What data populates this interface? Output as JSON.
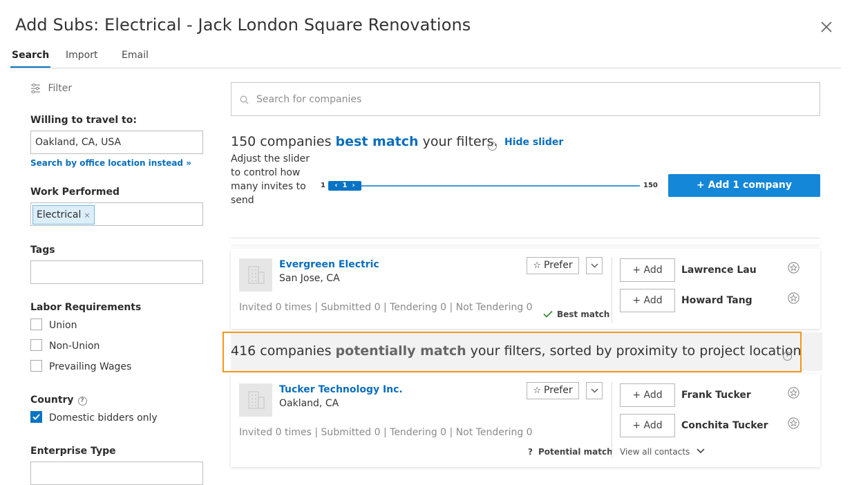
{
  "dialog": {
    "title": "Add Subs: Electrical - Jack London Square Renovations",
    "tabs": [
      {
        "label": "Search",
        "active": true
      },
      {
        "label": "Import",
        "active": false
      },
      {
        "label": "Email",
        "active": false
      }
    ]
  },
  "sidebar": {
    "filter_label": "Filter",
    "travel": {
      "label": "Willing to travel to:",
      "value": "Oakland, CA, USA",
      "office_link": "Search by office location instead »"
    },
    "work_performed": {
      "label": "Work Performed",
      "chip": "Electrical"
    },
    "tags": {
      "label": "Tags",
      "value": ""
    },
    "labor": {
      "label": "Labor Requirements",
      "options": [
        {
          "label": "Union",
          "checked": false
        },
        {
          "label": "Non-Union",
          "checked": false
        },
        {
          "label": "Prevailing Wages",
          "checked": false
        }
      ]
    },
    "country": {
      "label": "Country",
      "options": [
        {
          "label": "Domestic bidders only",
          "checked": true
        }
      ]
    },
    "enterprise_type": {
      "label": "Enterprise Type"
    }
  },
  "main": {
    "search_placeholder": "Search for companies",
    "best": {
      "prefix": "150 companies ",
      "em": "best match",
      "suffix": " your filters.",
      "hide_slider": "Hide slider",
      "slider_desc": "Adjust the slider to control how many invites to send",
      "slider_min": "1",
      "slider_max": "150",
      "slider_value": "1",
      "add_button": "+ Add 1 company"
    },
    "potential": {
      "prefix": "416 companies ",
      "em": "potentially match",
      "suffix": " your filters, sorted by proximity to project location"
    },
    "companies": [
      {
        "name": "Evergreen Electric",
        "location": "San Jose, CA",
        "stats": "Invited 0 times | Submitted 0 | Tendering 0 | Not Tendering 0",
        "prefer": "Prefer",
        "match": "Best match",
        "contacts": [
          {
            "add": "+ Add",
            "name": "Lawrence Lau"
          },
          {
            "add": "+ Add",
            "name": "Howard Tang"
          }
        ]
      },
      {
        "name": "Tucker Technology Inc.",
        "location": "Oakland, CA",
        "stats": "Invited 0 times | Submitted 0 | Tendering 0 | Not Tendering 0",
        "prefer": "Prefer",
        "match": "Potential match",
        "contacts": [
          {
            "add": "+ Add",
            "name": "Frank Tucker"
          },
          {
            "add": "+ Add",
            "name": "Conchita Tucker"
          }
        ],
        "view_all": "View all contacts"
      }
    ]
  },
  "colors": {
    "accent": "#0a74c4",
    "link": "#0a6ebd",
    "highlight_border": "#f3961b"
  }
}
